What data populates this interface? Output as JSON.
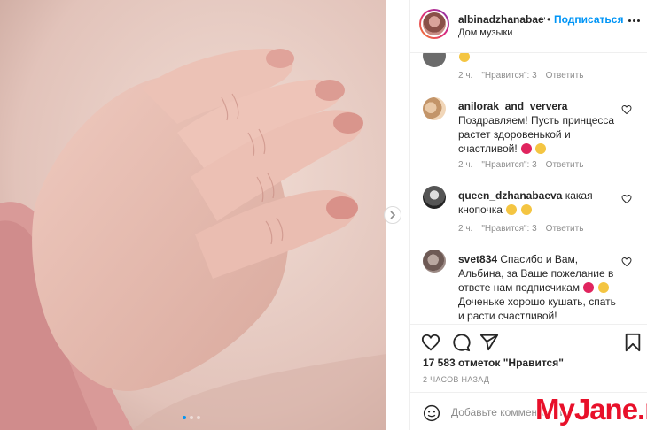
{
  "post": {
    "image_alt": "baby hand",
    "carousel": {
      "total_slides": 3,
      "active_slide": 1
    }
  },
  "header": {
    "username": "albinadzhanabaeva",
    "separator": "•",
    "follow_label": "Подписаться",
    "location": "Дом музыки",
    "more_icon": "more-dots-icon"
  },
  "comments": [
    {
      "username": "",
      "text": "",
      "emojis": [
        "#f4c542"
      ],
      "time": "2 ч.",
      "likes": "\"Нравится\": 3",
      "reply_label": "Ответить"
    },
    {
      "username": "anilorak_and_ververa",
      "text": "Поздравляем! Пусть принцесса растет здоровенькой и счастливой!",
      "emojis": [
        "#e0245e",
        "#f4c542"
      ],
      "time": "2 ч.",
      "likes": "\"Нравится\": 3",
      "reply_label": "Ответить"
    },
    {
      "username": "queen_dzhanabaeva",
      "text": "какая кнопочка",
      "emojis": [
        "#f4c542",
        "#f4c542"
      ],
      "time": "2 ч.",
      "likes": "\"Нравится\": 3",
      "reply_label": "Ответить"
    },
    {
      "username": "svet834",
      "text": "Спасибо и Вам, Альбина, за Ваше пожелание в ответе нам подписчикам",
      "text2": "Доченьке хорошо кушать, спать и расти счастливой!",
      "emojis": [
        "#e0245e",
        "#f4c542"
      ]
    }
  ],
  "actions": {
    "like_icon": "heart-icon",
    "comment_icon": "comment-icon",
    "share_icon": "share-icon",
    "save_icon": "bookmark-icon"
  },
  "likes_text": "17 583 отметок \"Нравится\"",
  "timestamp": "2 ЧАСОВ НАЗАД",
  "comment_input": {
    "placeholder": "Добавьте комментарий..."
  },
  "watermark": "MyJane.ru",
  "colors": {
    "accent": "#0095f6",
    "text": "#262626",
    "muted": "#8e8e8e",
    "watermark": "#e8102a"
  }
}
